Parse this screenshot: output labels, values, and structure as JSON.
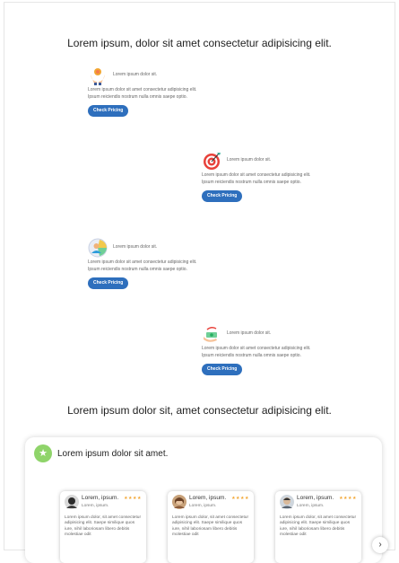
{
  "hero": {
    "title": "Lorem ipsum, dolor sit amet consectetur adipisicing elit."
  },
  "features": [
    {
      "name": "Lorem ipsum dolor sit.",
      "icon": "hands-sun-icon",
      "description": "Lorem ipsum dolor sit amet consectetur adipisicing elit. Ipsum reiciendis nostrum nulla omnis saepe optio.",
      "button": "Check Pricing"
    },
    {
      "name": "Lorem ipsum dolor sit.",
      "icon": "target-icon",
      "description": "Lorem ipsum dolor sit amet consectetur adipisicing elit. Ipsum reiciendis nostrum nulla omnis saepe optio.",
      "button": "Check Pricing"
    },
    {
      "name": "Lorem ipsum dolor sit.",
      "icon": "user-badge-icon",
      "description": "Lorem ipsum dolor sit amet consectetur adipisicing elit. Ipsum reiciendis nostrum nulla omnis saepe optio.",
      "button": "Check Pricing"
    },
    {
      "name": "Lorem ipsum dolor sit.",
      "icon": "money-hand-icon",
      "description": "Lorem ipsum dolor sit amet consectetur adipisicing elit. Ipsum reiciendis nostrum nulla omnis saepe optio.",
      "button": "Check Pricing"
    }
  ],
  "testimonials": {
    "section_title": "Lorem ipsum dolor sit, amet consectetur adipisicing elit.",
    "card_title": "Lorem ipsum dolor sit amet.",
    "rating_stars": "★★★★",
    "reviews": [
      {
        "name": "Lorem, ipsum.",
        "subtitle": "Lorem, ipsum.",
        "text": "Lorem ipsum dolor, sit amet consectetur adipisicing elit. Saepe similique quos iure, nihil laboriosam libero debitis molestiae odit"
      },
      {
        "name": "Lorem, ipsum.",
        "subtitle": "Lorem, ipsum.",
        "text": "Lorem ipsum dolor, sit amet consectetur adipisicing elit. Saepe similique quos iure, nihil laboriosam libero debitis molestiae odit"
      },
      {
        "name": "Lorem, ipsum.",
        "subtitle": "Lorem, ipsum.",
        "text": "Lorem ipsum dolor, sit amet consectetur adipisicing elit. Saepe similique quos iure, nihil laboriosam libero debitis molestiae odit"
      }
    ],
    "next_label": "›"
  },
  "colors": {
    "accent": "#2e6fbd",
    "star": "#f2a531",
    "badge": "#8fd46a"
  }
}
